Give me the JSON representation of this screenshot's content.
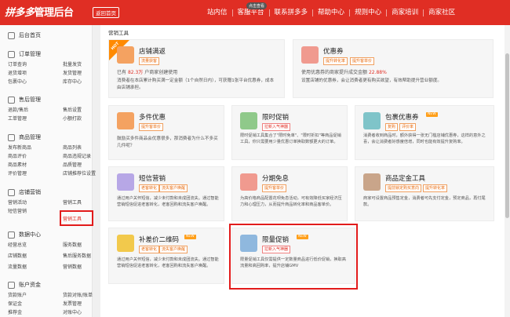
{
  "header": {
    "logo_brand": "拼多多",
    "logo_suffix": "管理后台",
    "back_button": "返回首页",
    "nav": [
      "站内信",
      "客服平台",
      "联系拼多多",
      "帮助中心",
      "规则中心",
      "商家培训",
      "商家社区"
    ],
    "nav_hint": "点击查看"
  },
  "sidebar": {
    "home": "后台首页",
    "sections": [
      {
        "title": "订单管理",
        "items": [
          "订单查询",
          "批量发货",
          "退货增项",
          "发货管理",
          "包裹中心",
          "库存中心"
        ]
      },
      {
        "title": "售后管理",
        "items": [
          "退款/售后",
          "售后设置",
          "工单管理",
          "小额打款"
        ]
      },
      {
        "title": "商品管理",
        "items": [
          "发布新商品",
          "商品列表",
          "商品评价",
          "商品违规记录",
          "商品素材",
          "品质管理",
          "评价管理",
          "店铺推荐位设置"
        ]
      },
      {
        "title": "店铺营销",
        "items": [
          "营销活动",
          "营销工具",
          "短信营销",
          "营销工具"
        ]
      },
      {
        "title": "数据中心",
        "items": [
          "经营总览",
          "服务数据",
          "店铺数据",
          "售后服务数据",
          "流量数据",
          "营销数据"
        ]
      },
      {
        "title": "账户资金",
        "items": [
          "货款账户",
          "货款对账/账单",
          "保证金",
          "发票管理",
          "推荐金",
          "对账中心"
        ]
      }
    ]
  },
  "breadcrumb": "营销工具",
  "cards": [
    {
      "title": "店铺满返",
      "tags": [
        "流量获客"
      ],
      "stats": "已有",
      "stats_num": "82.3万",
      "stats_suffix": "户商家创建使用",
      "desc": "消费者在本店累计购买满一定金额（1个自然日内），可获赠1张平台优惠券，成本由店铺承担。",
      "badge": "HOT"
    },
    {
      "title": "优惠券",
      "tags": [
        "提升转化率",
        "提升客单价"
      ],
      "stats": "使用优惠券的商家提升成交金额",
      "stats_num": "22.88%",
      "desc": "设置店铺的优惠券，会让消费者更有购买欲望，有效帮助提升营业额度。"
    },
    {
      "title": "多件优惠",
      "tags": [
        "提升客单价"
      ],
      "desc": "鼓励买多件商品会优惠很多，那消费者为什么不多买几件呢？"
    },
    {
      "title": "限时促销",
      "tags": [
        "拉新入气神器"
      ],
      "desc": "限时促销工具集合了\"限时免单\"、\"限时折扣\"等商品促销工具，你只需要用少量优惠订单换取数额更大的订单。"
    },
    {
      "title": "包裹优惠券",
      "tags": [
        "复购",
        "评价率"
      ],
      "desc": "消费者收到商品时，额外获得一张无门槛店铺优惠券，这样的意外之喜，会让消费者好感度倍增，同时也能有效提升复购率。",
      "new": "NEW"
    },
    {
      "title": "短信营销",
      "tags": [
        "老客转化",
        "流失客户唤醒"
      ],
      "desc": "通过用户关怀短信，减少未付款和未成团流失。通过智能营销短信促进老客转化，老客回购和流失客户唤醒。"
    },
    {
      "title": "分期免息",
      "tags": [
        "提升客单价"
      ],
      "desc": "为高价格商品配置花呗免息活动，可有效降低买家经济压力和心理压力，从而提升商品转化率和商品客单价。"
    },
    {
      "title": "商品定金工具",
      "tags": [
        "提前锁定购买意向",
        "提升转化率"
      ],
      "desc": "商家可设置商品预售定金，消费者可先支付定金，预定商品，再付尾款。"
    },
    {
      "title": "补差价二维码",
      "tags": [
        "老客转化",
        "流失客户唤醒"
      ],
      "desc": "通过用户关怀短信，减少未付款和未成团流失。通过智能营销短信促进老客转化，老客回购和流失客户唤醒。",
      "new": "NEW"
    },
    {
      "title": "限量促销",
      "tags": [
        "拉新入气神器"
      ],
      "desc": "限量促销工具仅需提供一定数量商品进行低价促销，换取高流量和高回购率，提升店铺GMV",
      "new": "NEW"
    }
  ],
  "colors": {
    "brand": "#e02e24",
    "accent": "#ff8a00",
    "icon_orange": "#f4a261",
    "icon_green": "#8fc98a",
    "icon_teal": "#7fc4c9",
    "icon_purple": "#b7a7e6",
    "icon_red": "#f09a8f",
    "icon_yellow": "#f2c94c",
    "icon_blue": "#8fb8de",
    "icon_brown": "#c9a58a"
  }
}
